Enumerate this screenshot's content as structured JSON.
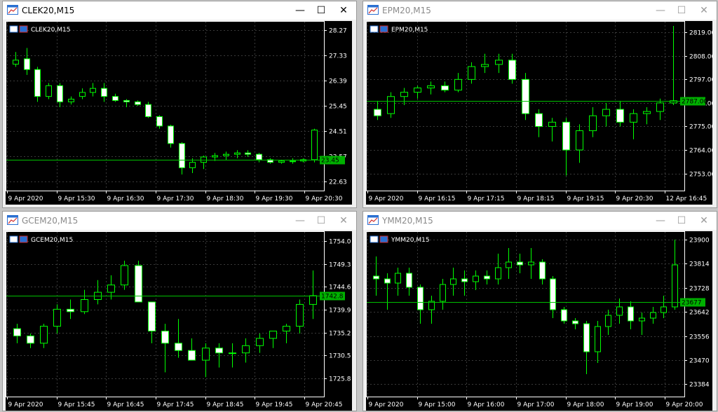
{
  "colors": {
    "background": "#000000",
    "grid": "#3a3a3a",
    "bull_body": "#000000",
    "bull_wick": "#00ff00",
    "bear_body": "#ffffff",
    "bear_wick": "#00ff00",
    "axis_text": "#ffffff",
    "price_line": "#00c000",
    "price_label_bg": "#00b000"
  },
  "windows": [
    {
      "title": "CLEK20,M15",
      "symbol_label": "CLEK20,M15",
      "active": true,
      "buttons": {
        "minimize": "—",
        "maximize": "☐",
        "close": "✕"
      }
    },
    {
      "title": "EPM20,M15",
      "symbol_label": "EPM20,M15",
      "active": false,
      "buttons": {
        "minimize": "—",
        "maximize": "☐",
        "close": "✕"
      }
    },
    {
      "title": "GCEM20,M15",
      "symbol_label": "GCEM20,M15",
      "active": false,
      "buttons": {
        "minimize": "—",
        "maximize": "☐",
        "close": "✕"
      }
    },
    {
      "title": "YMM20,M15",
      "symbol_label": "YMM20,M15",
      "active": false,
      "buttons": {
        "minimize": "—",
        "maximize": "☐",
        "close": "✕"
      }
    }
  ],
  "chart_data": [
    {
      "type": "candlestick",
      "symbol": "CLEK20,M15",
      "ylim": [
        22.3,
        28.5
      ],
      "y_ticks": [
        "28.27",
        "27.33",
        "26.39",
        "25.45",
        "24.51",
        "23.57",
        "22.63"
      ],
      "x_ticks": [
        "9 Apr 2020",
        "9 Apr 15:30",
        "9 Apr 16:30",
        "9 Apr 17:30",
        "9 Apr 18:30",
        "9 Apr 19:30",
        "9 Apr 20:30"
      ],
      "current_price": "23.45",
      "candles": [
        [
          27.0,
          27.45,
          26.9,
          27.15
        ],
        [
          27.2,
          27.6,
          26.6,
          26.8
        ],
        [
          26.8,
          26.9,
          25.6,
          25.8
        ],
        [
          25.8,
          26.3,
          25.7,
          26.2
        ],
        [
          26.2,
          26.3,
          25.4,
          25.6
        ],
        [
          25.6,
          25.8,
          25.5,
          25.7
        ],
        [
          25.8,
          26.1,
          25.7,
          25.95
        ],
        [
          25.95,
          26.3,
          25.8,
          26.1
        ],
        [
          26.1,
          26.3,
          25.6,
          25.8
        ],
        [
          25.8,
          25.9,
          25.6,
          25.65
        ],
        [
          25.65,
          25.7,
          25.4,
          25.6
        ],
        [
          25.6,
          25.65,
          25.45,
          25.5
        ],
        [
          25.5,
          25.6,
          25.0,
          25.05
        ],
        [
          25.05,
          25.1,
          24.6,
          24.7
        ],
        [
          24.7,
          24.75,
          23.9,
          24.05
        ],
        [
          24.05,
          24.1,
          22.9,
          23.15
        ],
        [
          23.15,
          23.5,
          22.95,
          23.35
        ],
        [
          23.35,
          23.6,
          23.1,
          23.55
        ],
        [
          23.55,
          23.7,
          23.4,
          23.6
        ],
        [
          23.6,
          23.75,
          23.45,
          23.65
        ],
        [
          23.65,
          23.8,
          23.5,
          23.7
        ],
        [
          23.7,
          23.8,
          23.55,
          23.65
        ],
        [
          23.65,
          23.7,
          23.35,
          23.45
        ],
        [
          23.45,
          23.5,
          23.3,
          23.35
        ],
        [
          23.35,
          23.45,
          23.3,
          23.4
        ],
        [
          23.4,
          23.5,
          23.3,
          23.4
        ],
        [
          23.4,
          23.5,
          23.35,
          23.45
        ],
        [
          23.45,
          24.6,
          23.35,
          24.55
        ]
      ]
    },
    {
      "type": "candlestick",
      "symbol": "EPM20,M15",
      "ylim": [
        2745,
        2823
      ],
      "y_ticks": [
        "2819.00",
        "2808.00",
        "2797.00",
        "2786.00",
        "2775.00",
        "2764.00",
        "2753.00"
      ],
      "x_ticks": [
        "9 Apr 2020",
        "9 Apr 16:15",
        "9 Apr 17:15",
        "9 Apr 18:15",
        "9 Apr 19:15",
        "9 Apr 20:30",
        "12 Apr 16:45"
      ],
      "current_price": "2787.00",
      "candles": [
        [
          2783,
          2787,
          2778,
          2780
        ],
        [
          2781,
          2791,
          2779,
          2789
        ],
        [
          2789,
          2793,
          2785,
          2791
        ],
        [
          2791,
          2794,
          2788,
          2793
        ],
        [
          2793,
          2796,
          2790,
          2794
        ],
        [
          2794,
          2796,
          2791,
          2792
        ],
        [
          2792,
          2800,
          2791,
          2797
        ],
        [
          2797,
          2805,
          2795,
          2803
        ],
        [
          2803,
          2809,
          2800,
          2804
        ],
        [
          2804,
          2809,
          2800,
          2806
        ],
        [
          2806,
          2809,
          2795,
          2797
        ],
        [
          2797,
          2800,
          2778,
          2781
        ],
        [
          2781,
          2783,
          2770,
          2775
        ],
        [
          2775,
          2779,
          2768,
          2777
        ],
        [
          2777,
          2779,
          2752,
          2764
        ],
        [
          2764,
          2776,
          2758,
          2773
        ],
        [
          2773,
          2784,
          2770,
          2780
        ],
        [
          2780,
          2786,
          2775,
          2783
        ],
        [
          2783,
          2787,
          2775,
          2777
        ],
        [
          2777,
          2783,
          2769,
          2781
        ],
        [
          2781,
          2784,
          2776,
          2782
        ],
        [
          2782,
          2788,
          2778,
          2786
        ],
        [
          2786,
          2822,
          2785,
          2787
        ]
      ]
    },
    {
      "type": "candlestick",
      "symbol": "GCEM20,M15",
      "ylim": [
        1722,
        1755.5
      ],
      "y_ticks": [
        "1754.0",
        "1749.3",
        "1744.6",
        "1739.9",
        "1735.2",
        "1730.5",
        "1725.8"
      ],
      "x_ticks": [
        "9 Apr 2020",
        "9 Apr 15:45",
        "9 Apr 16:45",
        "9 Apr 17:45",
        "9 Apr 18:45",
        "9 Apr 19:45",
        "9 Apr 20:45"
      ],
      "current_price": "1742.8",
      "candles": [
        [
          1736,
          1737,
          1733,
          1734.5
        ],
        [
          1734.5,
          1735,
          1732,
          1733
        ],
        [
          1733,
          1737,
          1732,
          1736.5
        ],
        [
          1736.5,
          1741,
          1735,
          1740
        ],
        [
          1740,
          1742,
          1738,
          1739.5
        ],
        [
          1739.5,
          1744,
          1739,
          1742
        ],
        [
          1742,
          1746,
          1741,
          1743.5
        ],
        [
          1743.5,
          1747,
          1742,
          1745
        ],
        [
          1745,
          1750,
          1744,
          1749
        ],
        [
          1749,
          1750,
          1744,
          1741.5
        ],
        [
          1741.5,
          1741.5,
          1733,
          1735.5
        ],
        [
          1735.5,
          1737,
          1727,
          1733
        ],
        [
          1733,
          1738,
          1730,
          1731.5
        ],
        [
          1731.5,
          1734,
          1730,
          1729.5
        ],
        [
          1729.5,
          1733,
          1726,
          1732
        ],
        [
          1732,
          1733,
          1728,
          1731
        ],
        [
          1731,
          1733,
          1728,
          1731
        ],
        [
          1731,
          1734,
          1729,
          1732.5
        ],
        [
          1732.5,
          1735,
          1731,
          1734
        ],
        [
          1734,
          1735,
          1732,
          1735.5
        ],
        [
          1735.5,
          1737,
          1733,
          1736.5
        ],
        [
          1736.5,
          1742,
          1735,
          1741
        ],
        [
          1741,
          1748,
          1738,
          1742.8
        ]
      ]
    },
    {
      "type": "candlestick",
      "symbol": "YMM20,M15",
      "ylim": [
        23340,
        23920
      ],
      "y_ticks": [
        "23900",
        "23814",
        "23728",
        "23642",
        "23556",
        "23470",
        "23384"
      ],
      "x_ticks": [
        "9 Apr 2020",
        "9 Apr 15:00",
        "9 Apr 16:00",
        "9 Apr 17:00",
        "9 Apr 18:00",
        "9 Apr 19:00",
        "9 Apr 20:00"
      ],
      "current_price": "23677",
      "candles": [
        [
          23770,
          23840,
          23700,
          23760
        ],
        [
          23760,
          23780,
          23650,
          23745
        ],
        [
          23745,
          23800,
          23700,
          23780
        ],
        [
          23780,
          23800,
          23700,
          23730
        ],
        [
          23730,
          23740,
          23600,
          23650
        ],
        [
          23650,
          23700,
          23600,
          23680
        ],
        [
          23680,
          23760,
          23650,
          23740
        ],
        [
          23740,
          23800,
          23700,
          23760
        ],
        [
          23760,
          23790,
          23700,
          23750
        ],
        [
          23750,
          23790,
          23720,
          23770
        ],
        [
          23770,
          23790,
          23740,
          23760
        ],
        [
          23760,
          23850,
          23740,
          23800
        ],
        [
          23800,
          23870,
          23760,
          23820
        ],
        [
          23820,
          23850,
          23780,
          23810
        ],
        [
          23810,
          23870,
          23760,
          23820
        ],
        [
          23820,
          23830,
          23740,
          23760
        ],
        [
          23760,
          23770,
          23620,
          23650
        ],
        [
          23650,
          23660,
          23600,
          23610
        ],
        [
          23610,
          23620,
          23580,
          23600
        ],
        [
          23600,
          23610,
          23420,
          23500
        ],
        [
          23500,
          23610,
          23460,
          23590
        ],
        [
          23590,
          23650,
          23560,
          23630
        ],
        [
          23630,
          23690,
          23600,
          23660
        ],
        [
          23660,
          23680,
          23580,
          23610
        ],
        [
          23610,
          23640,
          23560,
          23620
        ],
        [
          23620,
          23660,
          23600,
          23640
        ],
        [
          23640,
          23700,
          23620,
          23660
        ],
        [
          23660,
          23900,
          23650,
          23810
        ]
      ]
    }
  ]
}
